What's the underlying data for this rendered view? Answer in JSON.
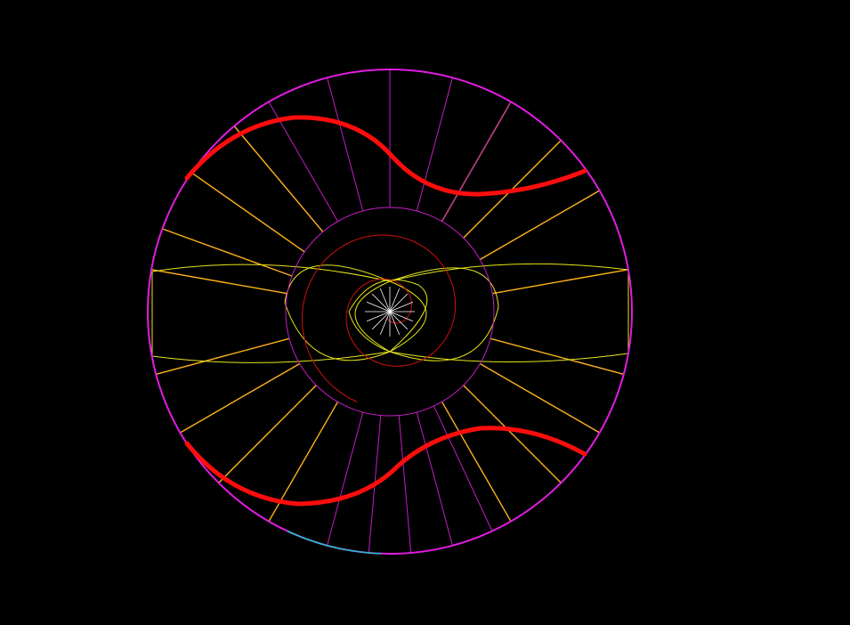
{
  "colors": {
    "background": "#000000",
    "outer_circle": "#e21ce2",
    "outer_arc_accent": "#19c6c6",
    "inner_circle": "#c51dc5",
    "spokes_upper": "#c51dc5",
    "spokes_orange": "#ffb31a",
    "yellow_curves": "#e6e619",
    "red_wave": "#ff0d0d",
    "red_spiral": "#cc1111",
    "white_spokes": "#ffffff"
  },
  "icons": [
    "lens-diagram",
    "spiral-curve",
    "sine-wave-band"
  ]
}
